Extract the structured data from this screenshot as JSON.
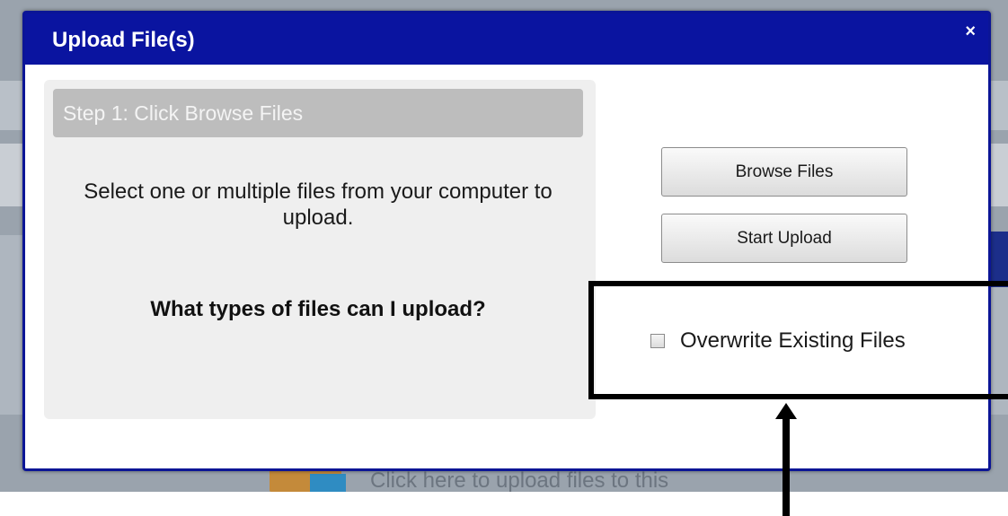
{
  "dialog": {
    "title": "Upload File(s)",
    "close_label": "×"
  },
  "step": {
    "header": "Step 1: Click Browse Files",
    "description": "Select one or multiple files from your computer to upload.",
    "file_types_link": "What types of files can I upload?"
  },
  "buttons": {
    "browse": "Browse Files",
    "start_upload": "Start Upload"
  },
  "options": {
    "overwrite_label": "Overwrite Existing Files",
    "overwrite_checked": false
  },
  "background": {
    "footer_text": "Click here to upload files to this"
  },
  "colors": {
    "header_blue": "#0a14a0",
    "panel_gray": "#efefef",
    "step_header_gray": "#bdbdbd"
  }
}
